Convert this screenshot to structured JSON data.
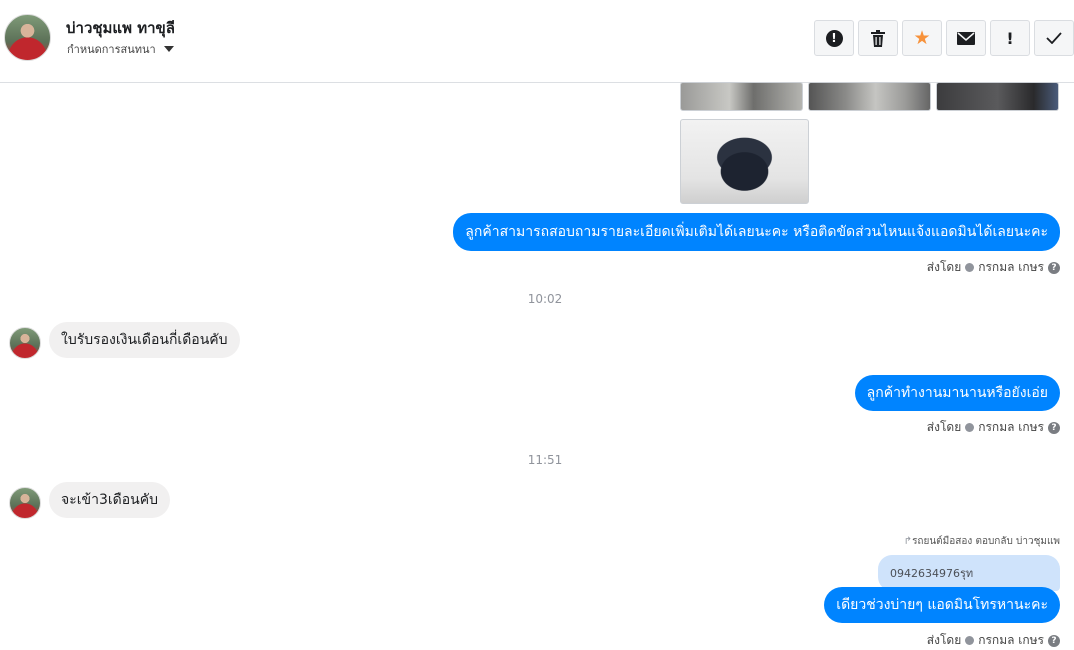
{
  "header": {
    "contact_name": "บ่าวชุมแพ ทาขุลี",
    "assign_label": "กำหนดการสนทนา"
  },
  "toolbar": {
    "buttons": [
      {
        "name": "spam-button",
        "icon": "alert-circle-icon",
        "glyph": "●"
      },
      {
        "name": "delete-button",
        "icon": "trash-icon",
        "glyph": "🗑"
      },
      {
        "name": "star-button",
        "icon": "star-icon",
        "glyph": "★"
      },
      {
        "name": "mark-unread-button",
        "icon": "envelope-icon",
        "glyph": "✉"
      },
      {
        "name": "follow-up-button",
        "icon": "exclamation-icon",
        "glyph": "!"
      },
      {
        "name": "done-button",
        "icon": "check-icon",
        "glyph": "✓"
      }
    ]
  },
  "colors": {
    "accent": "#0084ff",
    "star": "#f7923b",
    "incoming_bubble": "#f1f0f0",
    "quoted_bubble": "#cfe3fb"
  },
  "messages": {
    "out1": "ลูกค้าสามารถสอบถามรายละเอียดเพิ่มเติมได้เลยนะคะ หรือติดขัดส่วนไหนแจ้งแอดมินได้เลยนะคะ",
    "time1": "10:02",
    "in1": "ใบรับรองเงินเดือนกี่เดือนคับ",
    "out2": "ลูกค้าทำงานมานานหรือยังเอ่ย",
    "time2": "11:51",
    "in2": "จะเข้า3เดือนคับ",
    "reply_note": "รถยนต์มือสอง ตอบกลับ บ่าวชุมแพ",
    "quoted": "0942634976รุท",
    "out3": "เดียวช่วงบ่ายๆ แอดมินโทรหานะคะ"
  },
  "sent_by": {
    "label": "ส่งโดย",
    "name": "กรกมล เกษร",
    "help": "?"
  }
}
